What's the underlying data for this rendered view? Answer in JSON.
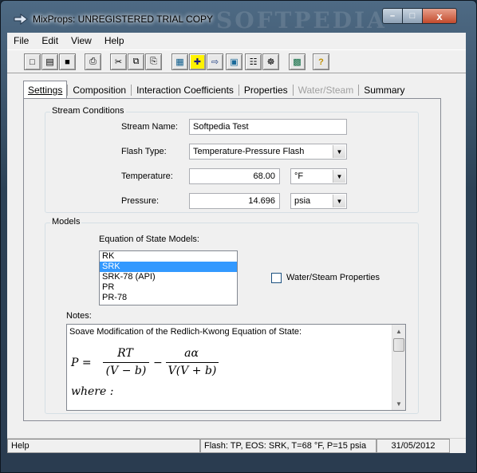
{
  "window": {
    "title": "MixProps:  UNREGISTERED TRIAL COPY",
    "watermark": "SOFTPEDIA",
    "close_glyph": "x",
    "min_glyph": "–",
    "max_glyph": "□"
  },
  "menu": [
    "File",
    "Edit",
    "View",
    "Help"
  ],
  "toolbar": {
    "icons": [
      "new-icon",
      "open-icon",
      "save-icon",
      "print-icon",
      "cut-icon",
      "copy-icon",
      "paste-icon",
      "calculator-icon",
      "add-component-icon",
      "flowchart-icon",
      "report-icon",
      "table-icon",
      "table2-icon",
      "export-icon",
      "help-icon"
    ],
    "glyphs": [
      "□",
      "▤",
      "■",
      "⎙",
      "✂",
      "⧉",
      "⎘",
      "▦",
      "✚",
      "⇨",
      "▣",
      "☷",
      "☸",
      "▩",
      "?"
    ]
  },
  "tabs": [
    {
      "label": "Settings",
      "active": true
    },
    {
      "label": "Composition"
    },
    {
      "label": "Interaction Coefficients"
    },
    {
      "label": "Properties"
    },
    {
      "label": "Water/Steam",
      "disabled": true
    },
    {
      "label": "Summary"
    }
  ],
  "stream": {
    "group_label": "Stream Conditions",
    "name_label": "Stream Name:",
    "name_value": "Softpedia Test",
    "flash_label": "Flash Type:",
    "flash_value": "Temperature-Pressure Flash",
    "temp_label": "Temperature:",
    "temp_value": "68.00",
    "temp_unit": "°F",
    "press_label": "Pressure:",
    "press_value": "14.696",
    "press_unit": "psia"
  },
  "models": {
    "group_label": "Models",
    "eos_label": "Equation of State Models:",
    "eos_items": [
      "RK",
      "SRK",
      "SRK-78 (API)",
      "PR",
      "PR-78"
    ],
    "selected": "SRK",
    "water_steam_label": "Water/Steam Properties",
    "water_steam_checked": false,
    "notes_label": "Notes:",
    "notes_text": "Soave Modification of the Redlich-Kwong Equation of State:",
    "eq_P": "P =",
    "eq_RT": "RT",
    "eq_den1": "(V − b)",
    "eq_minus": "−",
    "eq_aalpha": "aα",
    "eq_den2": "V(V + b)",
    "eq_where": "where :"
  },
  "status": {
    "help": "Help",
    "flash": "Flash: TP, EOS: SRK, T=68 °F, P=15 psia",
    "date": "31/05/2012"
  }
}
